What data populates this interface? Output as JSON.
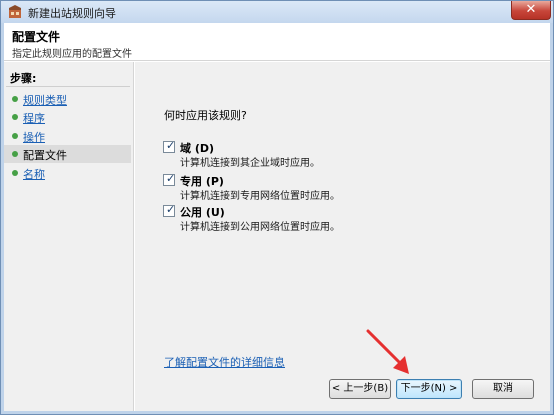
{
  "window": {
    "title": "新建出站规则向导",
    "close_glyph": "✕"
  },
  "header": {
    "title": "配置文件",
    "subtitle": "指定此规则应用的配置文件"
  },
  "steps": {
    "heading": "步骤:",
    "items": [
      {
        "label": "规则类型"
      },
      {
        "label": "程序"
      },
      {
        "label": "操作"
      },
      {
        "label": "配置文件"
      },
      {
        "label": "名称"
      }
    ]
  },
  "main": {
    "question": "何时应用该规则?",
    "options": [
      {
        "label": "域 (D)",
        "description": "计算机连接到其企业域时应用。",
        "checked": true
      },
      {
        "label": "专用 (P)",
        "description": "计算机连接到专用网络位置时应用。",
        "checked": true
      },
      {
        "label": "公用 (U)",
        "description": "计算机连接到公用网络位置时应用。",
        "checked": true
      }
    ],
    "learn_more": "了解配置文件的详细信息"
  },
  "buttons": {
    "back": "< 上一步(B)",
    "next": "下一步(N) >",
    "cancel": "取消"
  },
  "colors": {
    "link": "#1a5fb4",
    "bullet": "#46a046",
    "annotation_arrow": "#e53030"
  }
}
